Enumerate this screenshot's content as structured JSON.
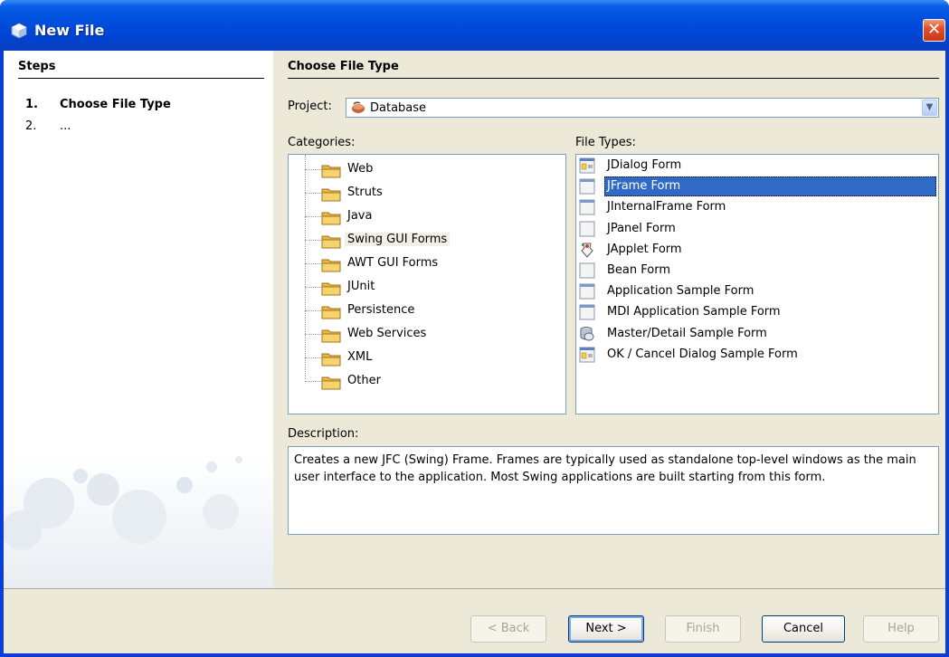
{
  "window": {
    "title": "New File",
    "close_glyph": "✕"
  },
  "steps": {
    "heading": "Steps",
    "items": [
      {
        "num": "1.",
        "label": "Choose File Type",
        "active": true
      },
      {
        "num": "2.",
        "label": "...",
        "active": false
      }
    ]
  },
  "main": {
    "heading": "Choose File Type",
    "project_label": "Project:",
    "project_value": "Database",
    "categories_label": "Categories:",
    "file_types_label": "File Types:",
    "categories": [
      "Web",
      "Struts",
      "Java",
      "Swing GUI Forms",
      "AWT GUI Forms",
      "JUnit",
      "Persistence",
      "Web Services",
      "XML",
      "Other"
    ],
    "selected_category": "Swing GUI Forms",
    "file_types": [
      {
        "name": "JDialog Form",
        "icon": "dialog-form-icon"
      },
      {
        "name": "JFrame Form",
        "icon": "frame-form-icon"
      },
      {
        "name": "JInternalFrame Form",
        "icon": "frame-form-icon"
      },
      {
        "name": "JPanel Form",
        "icon": "panel-form-icon"
      },
      {
        "name": "JApplet Form",
        "icon": "applet-form-icon"
      },
      {
        "name": "Bean Form",
        "icon": "panel-form-icon"
      },
      {
        "name": "Application Sample Form",
        "icon": "frame-form-icon"
      },
      {
        "name": "MDI Application Sample Form",
        "icon": "frame-form-icon"
      },
      {
        "name": "Master/Detail Sample Form",
        "icon": "database-form-icon"
      },
      {
        "name": "OK / Cancel Dialog Sample Form",
        "icon": "dialog-form-icon"
      }
    ],
    "selected_file_type": "JFrame Form",
    "description_label": "Description:",
    "description": "Creates a new JFC (Swing) Frame. Frames are typically used as standalone top-level windows as the main user interface to the application. Most Swing applications are built starting from this form."
  },
  "buttons": {
    "back": "< Back",
    "next": "Next >",
    "finish": "Finish",
    "cancel": "Cancel",
    "help": "Help"
  },
  "colors": {
    "title_bar": "#0053e0",
    "selection": "#316ac5",
    "dialog_bg": "#ece9d8"
  }
}
